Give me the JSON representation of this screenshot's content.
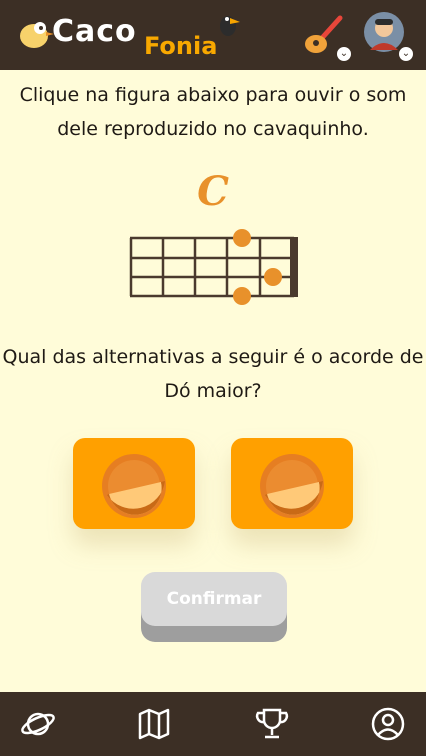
{
  "header": {
    "logo_main": "Caco",
    "logo_sub": "Fonia"
  },
  "instruction": "Clique na figura abaixo para ouvir o som dele reproduzido no cavaquinho.",
  "chord": {
    "name": "C"
  },
  "question": "Qual das alternativas a seguir é o acorde de Dó maior?",
  "confirm_label": "Confirmar",
  "colors": {
    "topbar": "#3c2f25",
    "background": "#fffcd9",
    "accent": "#ffa000",
    "chord_dot": "#e8912b"
  },
  "icons": {
    "nav_1": "planet-icon",
    "nav_2": "map-icon",
    "nav_3": "trophy-icon",
    "nav_4": "user-icon"
  }
}
